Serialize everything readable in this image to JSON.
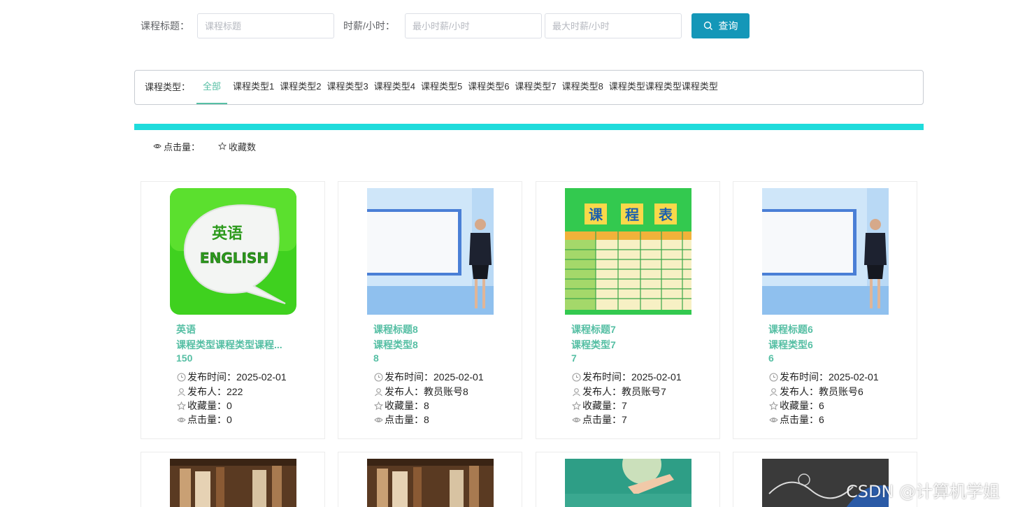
{
  "search": {
    "title_label": "课程标题：",
    "title_placeholder": "课程标题",
    "wage_label": "时薪/小时：",
    "min_placeholder": "最小时薪/小时",
    "max_placeholder": "最大时薪/小时",
    "button_label": "查询",
    "accent": "#1497b8"
  },
  "types": {
    "label": "课程类型：",
    "items": [
      "全部",
      "课程类型1",
      "课程类型2",
      "课程类型3",
      "课程类型4",
      "课程类型5",
      "课程类型6",
      "课程类型7",
      "课程类型8",
      "课程类型课程类型课程类型"
    ],
    "active": "全部",
    "active_color": "#56bfa4"
  },
  "sort": {
    "clicks": "点击量：",
    "favorites": "收藏数"
  },
  "labels": {
    "publish_time": "发布时间：",
    "publisher": "发布人：",
    "favorites": "收藏量：",
    "clicks": "点击量："
  },
  "cards": [
    {
      "title": "英语",
      "type": "课程类型课程类型课程...",
      "price": "150",
      "date": "2025-02-01",
      "publisher": "222",
      "favorites": "0",
      "clicks": "0",
      "image": "english-leaf-logo"
    },
    {
      "title": "课程标题8",
      "type": "课程类型8",
      "price": "8",
      "date": "2025-02-01",
      "publisher": "教员账号8",
      "favorites": "8",
      "clicks": "8",
      "image": "teacher-presentation"
    },
    {
      "title": "课程标题7",
      "type": "课程类型7",
      "price": "7",
      "date": "2025-02-01",
      "publisher": "教员账号7",
      "favorites": "7",
      "clicks": "7",
      "image": "timetable"
    },
    {
      "title": "课程标题6",
      "type": "课程类型6",
      "price": "6",
      "date": "2025-02-01",
      "publisher": "教员账号6",
      "favorites": "6",
      "clicks": "6",
      "image": "teacher-presentation"
    }
  ],
  "thumb_texts": {
    "english_cn": "英语",
    "english_en": "ENGLISH",
    "timetable_chars": [
      "课",
      "程",
      "表"
    ]
  },
  "watermark": "CSDN @计算机学姐"
}
